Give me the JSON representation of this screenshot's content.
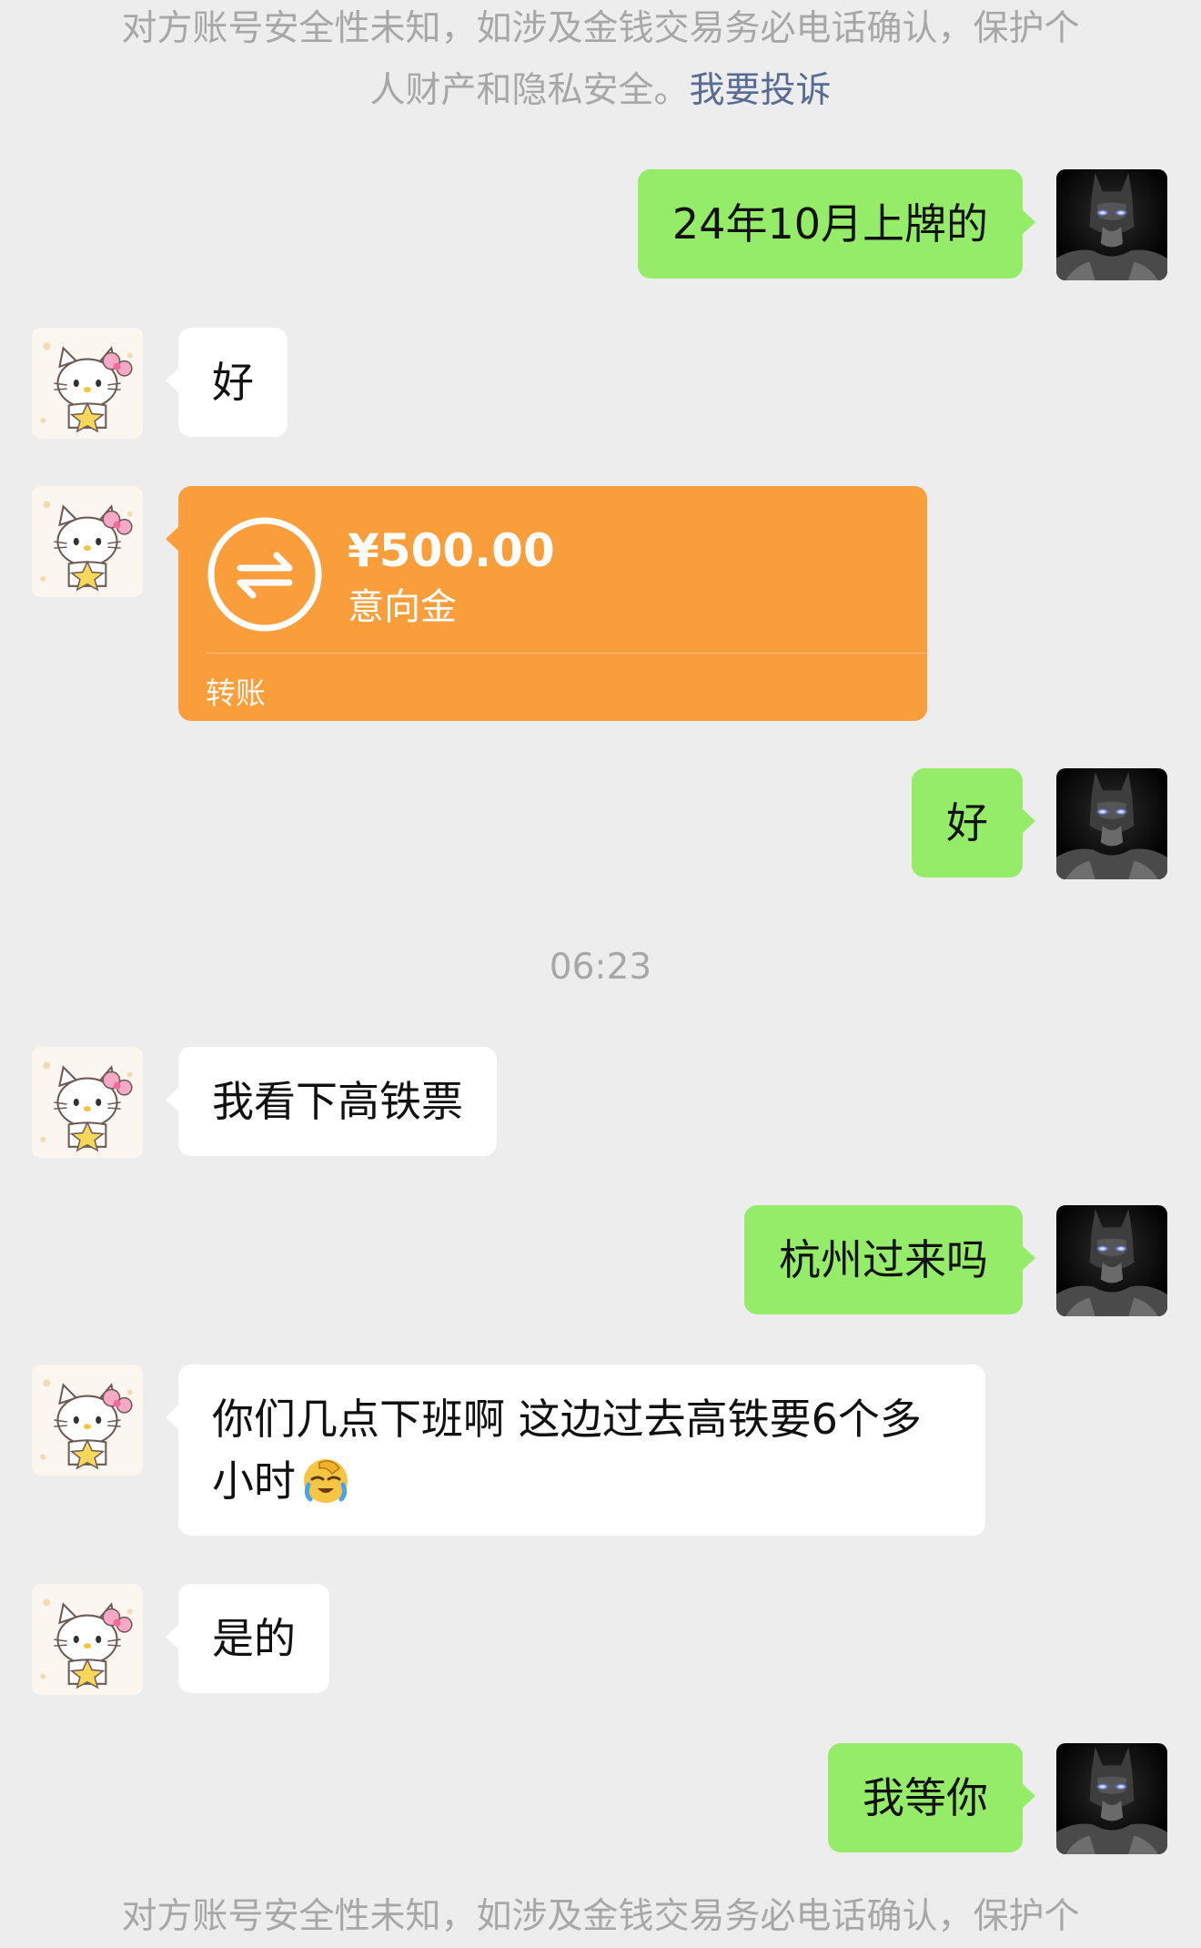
{
  "security_notice": {
    "line1": "对方账号安全性未知，如涉及金钱交易务必电话确认，保护个",
    "line2": "人财产和隐私安全。",
    "link": "我要投诉"
  },
  "messages": [
    {
      "from": "me",
      "text": "24年10月上牌的"
    },
    {
      "from": "other",
      "text": "好"
    },
    {
      "from": "other",
      "type": "transfer",
      "amount": "¥500.00",
      "memo": "意向金",
      "label": "转账"
    },
    {
      "from": "me",
      "text": "好"
    },
    {
      "type": "time",
      "text": "06:23"
    },
    {
      "from": "other",
      "text": "我看下高铁票"
    },
    {
      "from": "me",
      "text": "杭州过来吗"
    },
    {
      "from": "other",
      "text": "你们几点下班啊 这边过去高铁要6个多小时",
      "emoji": "facepalm-emoji"
    },
    {
      "from": "other",
      "text": "是的"
    },
    {
      "from": "me",
      "text": "我等你"
    }
  ],
  "bottom_notice": {
    "line1": "对方账号安全性未知，如涉及金钱交易务必电话确认，保护个"
  },
  "colors": {
    "background": "#ededed",
    "my_bubble": "#95ec69",
    "their_bubble": "#ffffff",
    "transfer_card": "#fa9d3b",
    "link": "#576b95",
    "system_text": "#a7a7a7"
  },
  "icons": {
    "my_avatar": "batman-avatar",
    "their_avatar": "hello-kitty-avatar",
    "transfer": "transfer-arrows-icon"
  }
}
